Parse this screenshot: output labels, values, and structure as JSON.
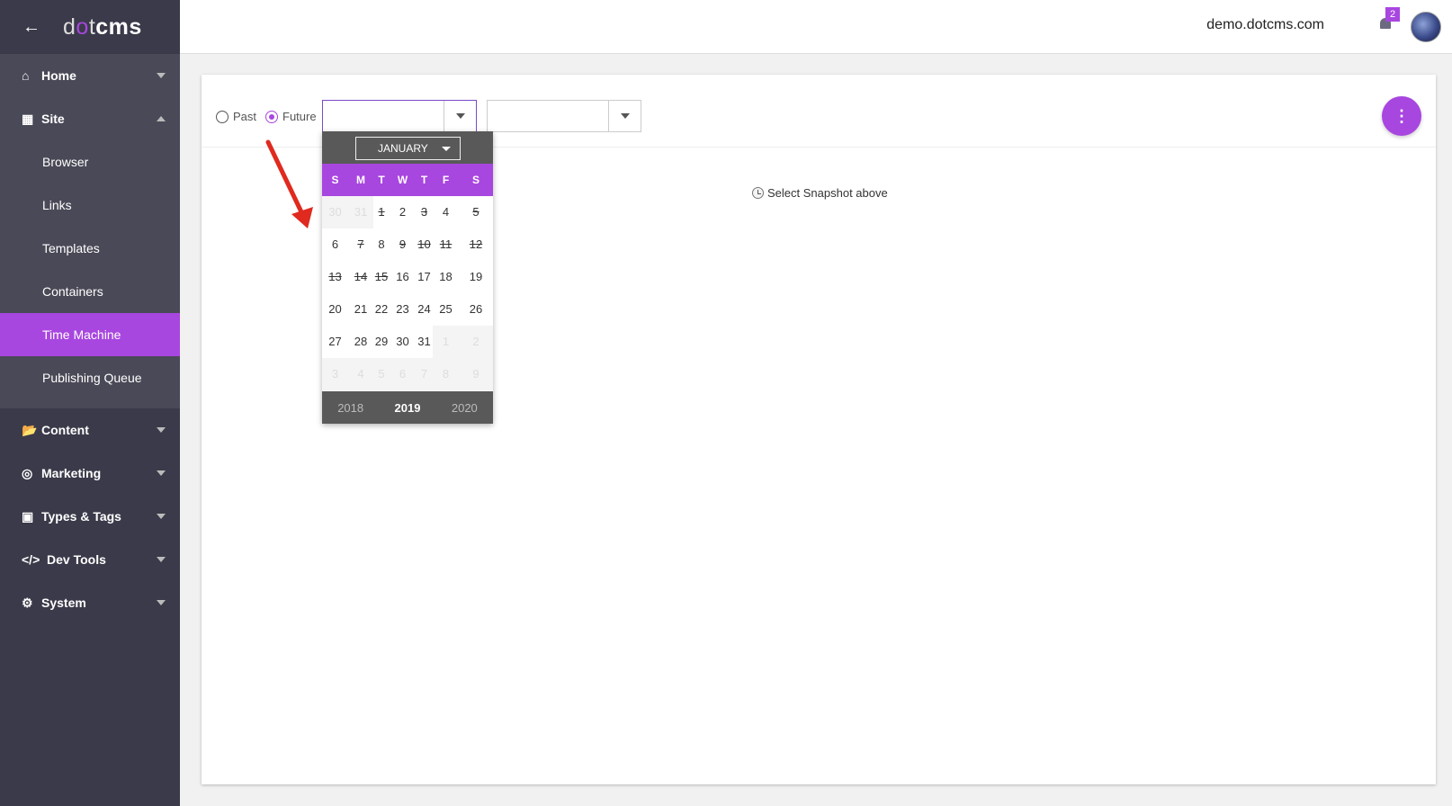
{
  "brand": {
    "logo_prefix": "d",
    "logo_dot": "o",
    "logo_mid": "t",
    "logo_bold": "cms"
  },
  "sidebar": {
    "items": [
      {
        "label": "Home",
        "icon": "home-icon"
      },
      {
        "label": "Site",
        "icon": "sitemap-icon"
      },
      {
        "label": "Content",
        "icon": "folder-open-icon"
      },
      {
        "label": "Marketing",
        "icon": "bullseye-icon"
      },
      {
        "label": "Types & Tags",
        "icon": "file-icon"
      },
      {
        "label": "Dev Tools",
        "icon": "code-icon"
      },
      {
        "label": "System",
        "icon": "gear-icon"
      }
    ],
    "site_sub": [
      {
        "label": "Browser"
      },
      {
        "label": "Links"
      },
      {
        "label": "Templates"
      },
      {
        "label": "Containers"
      },
      {
        "label": "Time Machine",
        "active": true
      },
      {
        "label": "Publishing Queue"
      }
    ]
  },
  "topbar": {
    "site": "demo.dotcms.com",
    "notifications": "2"
  },
  "filters": {
    "past": "Past",
    "future": "Future",
    "selected": "Future"
  },
  "message": "Select Snapshot above",
  "calendar": {
    "month": "JANUARY",
    "dow": [
      "S",
      "M",
      "T",
      "W",
      "T",
      "F",
      "S"
    ],
    "weeks": [
      [
        "30",
        "31",
        "1",
        "2",
        "3",
        "4",
        "5"
      ],
      [
        "6",
        "7",
        "8",
        "9",
        "10",
        "11",
        "12"
      ],
      [
        "13",
        "14",
        "15",
        "16",
        "17",
        "18",
        "19"
      ],
      [
        "20",
        "21",
        "22",
        "23",
        "24",
        "25",
        "26"
      ],
      [
        "27",
        "28",
        "29",
        "30",
        "31",
        "1",
        "2"
      ],
      [
        "3",
        "4",
        "5",
        "6",
        "7",
        "8",
        "9"
      ]
    ],
    "years": [
      "2018",
      "2019",
      "2020"
    ],
    "current_year": "2019"
  },
  "colors": {
    "accent": "#a846e0",
    "sidebar": "#3b3a4a",
    "sidebar_sub": "#4a4957",
    "annotation": "#e02a1f"
  }
}
